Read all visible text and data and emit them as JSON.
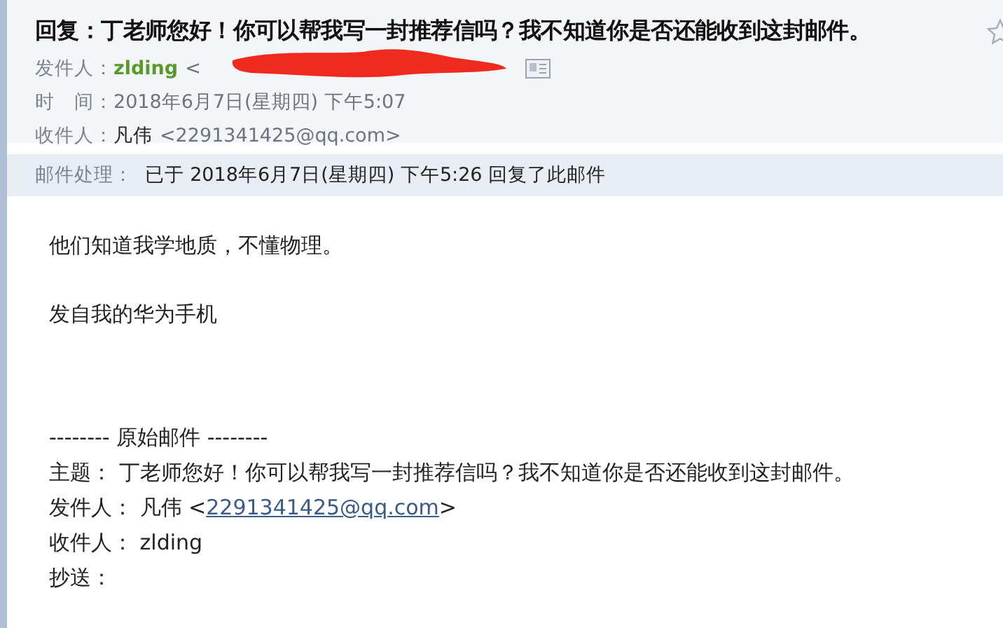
{
  "subject": "回复：丁老师您好！你可以帮我写一封推荐信吗？我不知道你是否还能收到这封邮件。",
  "header_fields": [
    {
      "label": "发件人：",
      "name": "zlding",
      "kind": "sender",
      "address": "<"
    },
    {
      "label": "时　间：",
      "kind": "time",
      "value": "2018年6月7日(星期四) 下午5:07"
    },
    {
      "label": "收件人：",
      "kind": "recipient",
      "name": "凡伟",
      "address": "<2291341425@qq.com>"
    }
  ],
  "processing": {
    "label": "邮件处理：",
    "value": "已于 2018年6月7日(星期四) 下午5:26 回复了此邮件"
  },
  "body": [
    "他们知道我学地质，不懂物理。",
    "发自我的华为手机"
  ],
  "original": {
    "separator": "-------- 原始邮件 --------",
    "lines": [
      {
        "label": "主题：",
        "value": "丁老师您好！你可以帮我写一封推荐信吗？我不知道你是否还能收到这封邮件。"
      },
      {
        "label": "发件人：",
        "value": "凡伟 <",
        "link": "2291341425@qq.com",
        "after": ">"
      },
      {
        "label": "收件人：",
        "value": "zlding"
      },
      {
        "label": "抄送："
      }
    ]
  }
}
